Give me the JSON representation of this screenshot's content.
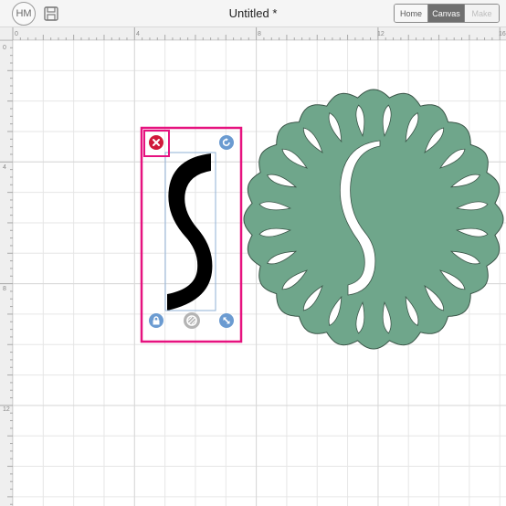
{
  "header": {
    "avatar_initials": "HM",
    "title": "Untitled *",
    "modes": [
      {
        "label": "Home",
        "state": "normal"
      },
      {
        "label": "Canvas",
        "state": "active"
      },
      {
        "label": "Make",
        "state": "disabled"
      }
    ]
  },
  "rulers": {
    "top_labels": [
      "0",
      "4",
      "8",
      "12",
      "16"
    ],
    "left_labels": [
      "0",
      "4",
      "8",
      "12"
    ]
  },
  "canvas": {
    "doily_color": "#6fa68b",
    "selection_color": "#e6127f",
    "delete_handle_color": "#d0193a",
    "handle_color": "#6b9bd1"
  },
  "icons": {
    "save": "save-icon",
    "delete": "close-icon",
    "rotate": "rotate-icon",
    "lock": "lock-icon",
    "weld": "weld-icon",
    "resize": "resize-icon"
  }
}
